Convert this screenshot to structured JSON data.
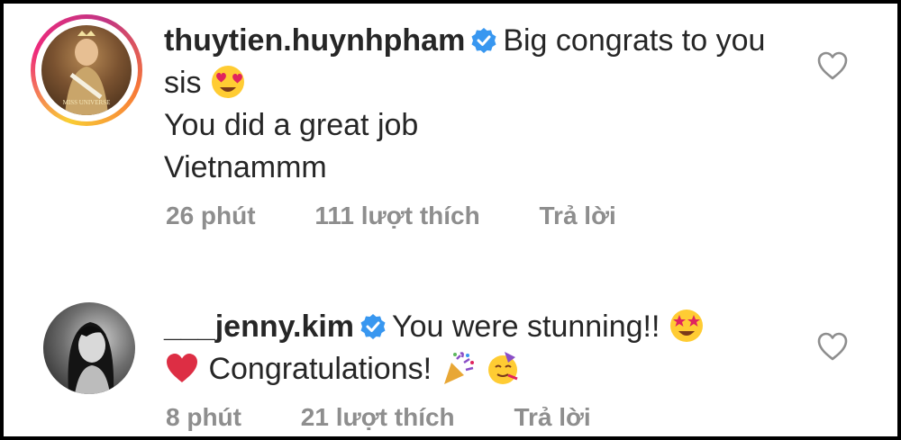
{
  "comments": [
    {
      "username": "thuytien.huynhpham",
      "text_part1": "Big congrats to you sis",
      "text_lines": [
        "You did a great job",
        "Vietnammm"
      ],
      "time": "26 phút",
      "likes": "111 lượt thích",
      "reply": "Trả lời",
      "avatar_caption": "MISS UNIVERSE"
    },
    {
      "username": "___jenny.kim",
      "text_part1": "You were stunning!!",
      "text_part2": "Congratulations!",
      "time": "8 phút",
      "likes": "21 lượt thích",
      "reply": "Trả lời"
    }
  ],
  "icons": {
    "verified": "verified-badge-icon",
    "like": "heart-outline-icon",
    "emojis": [
      "heart-eyes-emoji",
      "star-struck-emoji",
      "red-heart-emoji",
      "party-popper-emoji",
      "partying-face-emoji"
    ]
  },
  "colors": {
    "verified_blue": "#3897f0",
    "text": "#262626",
    "meta": "#8e8e8e"
  }
}
